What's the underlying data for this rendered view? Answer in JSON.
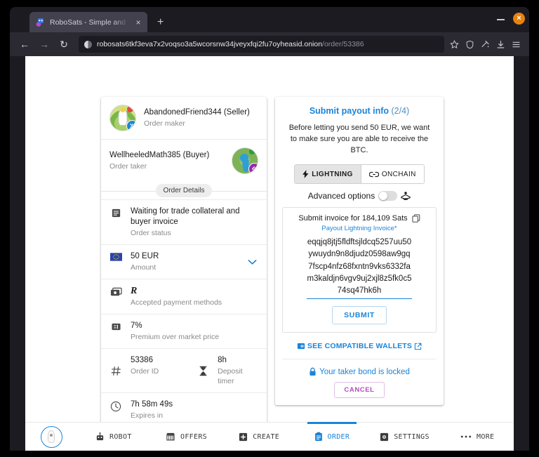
{
  "browser": {
    "tab": {
      "title": "RoboSats - Simple and Private Bitcoin Exchange",
      "close_label": "×",
      "favicon": "robosats-favicon"
    },
    "new_tab_label": "+",
    "window_controls": {
      "minimize": "minimize-icon",
      "close": "×"
    },
    "nav": {
      "back": "←",
      "forward": "→",
      "reload": "↻"
    },
    "url": {
      "host": "robosats6tkf3eva7x2voqso3a5wcorsnw34jveyxfqi2fu7oyheasid.onion",
      "path": "/order/53386"
    },
    "toolbar_icons": [
      "bookmark-star-icon",
      "shield-icon",
      "extensions-icon",
      "downloads-icon",
      "menu-icon"
    ]
  },
  "order_card": {
    "maker": {
      "name": "AbandonedFriend344 (Seller)",
      "role": "Order maker",
      "badge": "maker-badge"
    },
    "taker": {
      "name": "WellheeledMath385 (Buyer)",
      "role": "Order taker",
      "badge": "taker-badge"
    },
    "details_chip": "Order Details",
    "rows": [
      {
        "icon": "article-icon",
        "primary": "Waiting for trade collateral and buyer invoice",
        "secondary": "Order status"
      },
      {
        "icon": "eu-flag-icon",
        "primary": "50 EUR",
        "secondary": "Amount",
        "chevron": "chevron-down-icon"
      },
      {
        "icon": "payments-icon",
        "primary": "R",
        "secondary": "Accepted payment methods"
      },
      {
        "icon": "price-tag-icon",
        "primary": "7%",
        "secondary": "Premium over market price"
      },
      {
        "icon": "hash-icon",
        "primary": "53386",
        "secondary": "Order ID",
        "icon2": "hourglass-icon",
        "primary2": "8h",
        "secondary2": "Deposit timer"
      },
      {
        "icon": "clock-icon",
        "primary": "7h 58m 49s",
        "secondary": "Expires in"
      }
    ],
    "progress_color": "#1b84d8"
  },
  "payout_card": {
    "title": "Submit payout info",
    "step": "(2/4)",
    "description": "Before letting you send 50 EUR, we want to make sure you are able to receive the BTC.",
    "methods": [
      {
        "label": "LIGHTNING",
        "icon": "bolt-icon",
        "active": true
      },
      {
        "label": "ONCHAIN",
        "icon": "link-icon",
        "active": false
      }
    ],
    "advanced_options": {
      "label": "Advanced options",
      "toggle_state": "off",
      "icon": "self-improvement-icon"
    },
    "invoice": {
      "heading": "Submit invoice for 184,109 Sats",
      "copy_icon": "copy-icon",
      "field_label": "Payout Lightning Invoice*",
      "value": "eqqjq8jtj5fldftsjldcq5257uu50ywuydn9n8djudz0598aw9gq7fscp4nfz68fxntn9vks6332fam3kaldjn6vgv9uj2xjl8z5fk0c574sq47hk6h",
      "submit_label": "SUBMIT"
    },
    "wallets_link": {
      "label": "SEE COMPATIBLE WALLETS",
      "icon": "wallet-icon",
      "external_icon": "open-in-new-icon"
    },
    "bond": {
      "label": "Your taker bond is locked",
      "icon": "lock-icon"
    },
    "cancel_label": "CANCEL"
  },
  "bottom_nav": {
    "avatar": "user-robot-avatar",
    "items": [
      {
        "label": "ROBOT",
        "icon": "robot-icon",
        "active": false
      },
      {
        "label": "OFFERS",
        "icon": "storefront-icon",
        "active": false
      },
      {
        "label": "CREATE",
        "icon": "add-box-icon",
        "active": false
      },
      {
        "label": "ORDER",
        "icon": "assignment-icon",
        "active": true
      },
      {
        "label": "SETTINGS",
        "icon": "settings-icon",
        "active": false
      },
      {
        "label": "MORE",
        "icon": "more-horiz-icon",
        "active": false
      }
    ]
  }
}
